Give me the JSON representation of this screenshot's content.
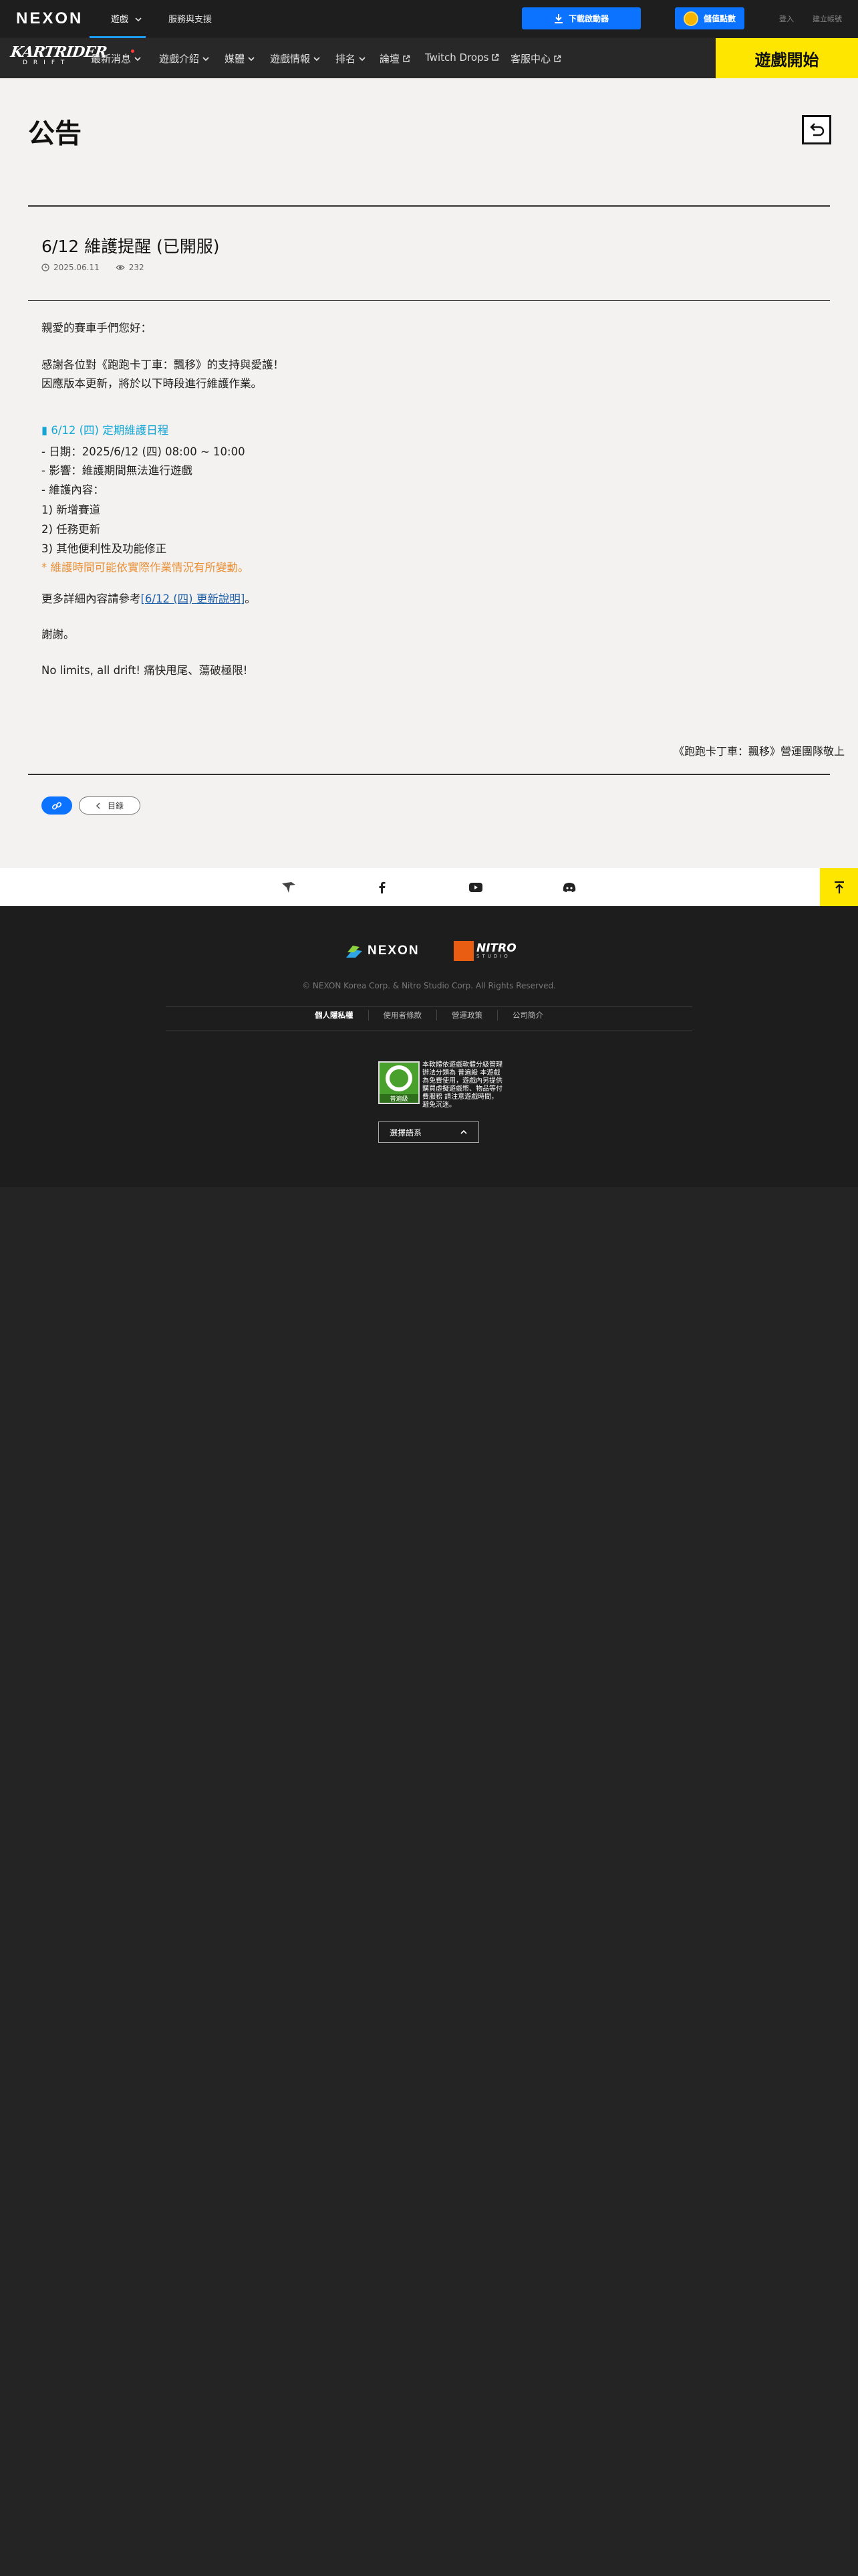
{
  "topbar": {
    "brand": "NEXON",
    "nav": [
      "遊戲",
      "服務與支援"
    ],
    "download_label": "下載啟動器",
    "points_label": "儲值點數",
    "links": [
      "登入",
      "建立帳號"
    ]
  },
  "gamenav": {
    "logo_text": "KARTRIDER",
    "logo_sub": "DRIFT",
    "items": [
      {
        "label": "最新消息",
        "icon": "chevron-down-icon"
      },
      {
        "label": "遊戲介紹",
        "icon": "chevron-down-icon"
      },
      {
        "label": "媒體",
        "icon": "chevron-down-icon"
      },
      {
        "label": "遊戲情報",
        "icon": "chevron-down-icon"
      },
      {
        "label": "排名",
        "icon": "chevron-down-icon"
      },
      {
        "label": "論壇",
        "icon": "external-link-icon"
      },
      {
        "label": "Twitch Drops",
        "icon": "external-link-icon"
      },
      {
        "label": "客服中心",
        "icon": "external-link-icon"
      }
    ],
    "play_label": "遊戲開始"
  },
  "page": {
    "title": "公告"
  },
  "post": {
    "title": "6/12 維護提醒 (已開服)",
    "date": "2025.06.11",
    "views": "232",
    "lines": [
      "親愛的賽車手們您好：",
      "感謝各位對《跑跑卡丁車：飄移》的支持與愛護！",
      "因應版本更新，將於以下時段進行維護作業。",
      "▮ 6/12 (四) 定期維護日程",
      "- 日期：2025/6/12 (四) 08:00 ~ 10:00",
      "- 影響：維護期間無法進行遊戲",
      "- 維護內容：",
      "1) 新增賽道",
      "2) 任務更新",
      "3) 其他便利性及功能修正",
      "* 維護時間可能依實際作業情況有所變動。",
      "更多詳細內容請參考",
      "[6/12 (四) 更新說明]",
      "。",
      "謝謝。",
      "No limits, all drift! 痛快甩尾、蕩破極限!"
    ],
    "signature": "《跑跑卡丁車：飄移》營運團隊敬上",
    "list_label": "目錄"
  },
  "social": {
    "icons": [
      "kartrider-drift-icon",
      "facebook-icon",
      "youtube-icon",
      "discord-icon"
    ]
  },
  "footer": {
    "nexon_logo": "NEXON",
    "nitro_logo": "NITRO",
    "nitro_sub": "STUDIO",
    "copyright": "© NEXON Korea Corp. & Nitro Studio Corp. All Rights Reserved.",
    "links": [
      "個人隱私權",
      "使用者條款",
      "營運政策",
      "公司簡介"
    ],
    "rating_label": "普遍級",
    "rating_text": "本軟體依遊戲軟體分級管理辦法分類為 普遍級 本遊戲為免費使用，遊戲內另提供購買虛擬遊戲幣、物品等付費服務 請注意遊戲時間，避免沉迷。",
    "language_label": "選擇語系"
  },
  "colors": {
    "accent_blue": "#0b73ff",
    "play_yellow": "#ffe600",
    "notice_cyan": "#14a7d6",
    "warning_orange": "#e8913a"
  }
}
